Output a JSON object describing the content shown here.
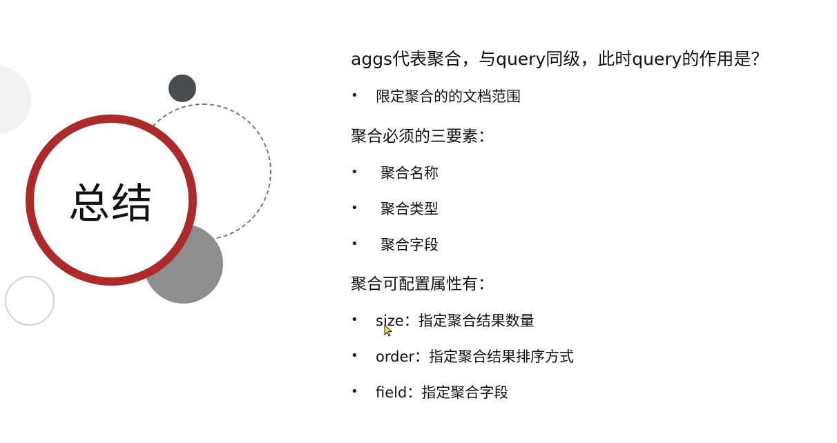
{
  "slide": {
    "title": "总结",
    "summary": {
      "question": "aggs代表聚合，与query同级，此时query的作用是？",
      "answer_items": [
        "限定聚合的的文档范围"
      ],
      "three_elements_heading": "聚合必须的三要素：",
      "three_elements": [
        "聚合名称",
        "聚合类型",
        "聚合字段"
      ],
      "config_heading": "聚合可配置属性有：",
      "config_items": [
        "size：指定聚合结果数量",
        "order：指定聚合结果排序方式",
        "field：指定聚合字段"
      ]
    },
    "bullet_glyph": "•"
  },
  "colors": {
    "accent_red": "#ad2a2b",
    "dark_dot": "#4a4d4f",
    "gray_circle": "#8e8e8e"
  }
}
